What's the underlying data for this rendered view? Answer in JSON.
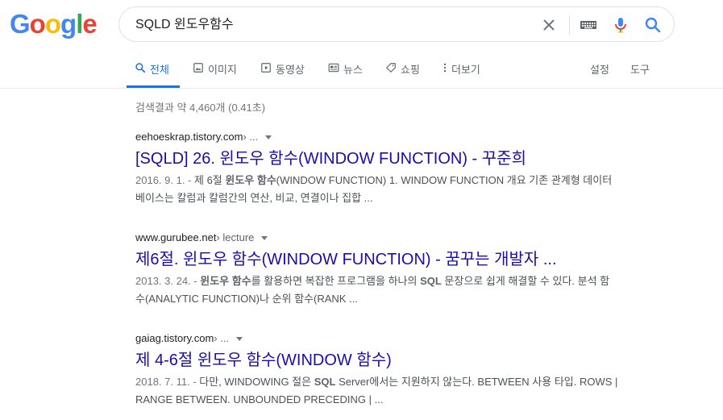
{
  "logo": {
    "letters": [
      "G",
      "o",
      "o",
      "g",
      "l",
      "e"
    ],
    "colors": [
      "#4285F4",
      "#EA4335",
      "#FBBC05",
      "#4285F4",
      "#34A853",
      "#EA4335"
    ]
  },
  "search": {
    "query": "SQLD 윈도우함수"
  },
  "icons": {
    "clear": "close-icon",
    "keyboard": "keyboard-icon",
    "voice": "microphone-icon",
    "search": "search-icon"
  },
  "tabs": [
    {
      "label": "전체",
      "icon": "search-icon",
      "active": true
    },
    {
      "label": "이미지",
      "icon": "image-icon"
    },
    {
      "label": "동영상",
      "icon": "video-icon"
    },
    {
      "label": "뉴스",
      "icon": "news-icon"
    },
    {
      "label": "쇼핑",
      "icon": "tag-icon"
    },
    {
      "label": "더보기",
      "icon": "more-vert-icon"
    }
  ],
  "tools": {
    "settings": "설정",
    "tools": "도구"
  },
  "stats": "검색결과 약 4,460개 (0.41초)",
  "results": [
    {
      "site": "eehoeskrap.tistory.com",
      "path": " › ...",
      "title": "[SQLD] 26. 윈도우 함수(WINDOW FUNCTION) - 꾸준희",
      "date": "2016. 9. 1. - ",
      "snippet": [
        {
          "t": "제 6절 "
        },
        {
          "t": "윈도우 함수",
          "b": true
        },
        {
          "t": "(WINDOW FUNCTION) 1. WINDOW FUNCTION 개요 기존 관계형 데이터베이스는 칼럼과 칼럼간의 연산, 비교, 연결이나 집합 ..."
        }
      ]
    },
    {
      "site": "www.gurubee.net",
      "path": " › lecture",
      "title": "제6절. 윈도우 함수(WINDOW FUNCTION) - 꿈꾸는 개발자 ...",
      "date": "2013. 3. 24. - ",
      "snippet": [
        {
          "t": "윈도우 함수",
          "b": true
        },
        {
          "t": "를 활용하면 복잡한 프로그램을 하나의 "
        },
        {
          "t": "SQL",
          "b": true
        },
        {
          "t": " 문장으로 쉽게 해결할 수 있다. 분석 함수(ANALYTIC FUNCTION)나 순위 함수(RANK ..."
        }
      ]
    },
    {
      "site": "gaiag.tistory.com",
      "path": " › ...",
      "title": "제 4-6절 윈도우 함수(WINDOW 함수)",
      "date": "2018. 7. 11. - ",
      "snippet": [
        {
          "t": "다만, WINDOWING 절은 "
        },
        {
          "t": "SQL",
          "b": true
        },
        {
          "t": " Server에서는 지원하지 않는다. BETWEEN 사용 타입. ROWS | RANGE BETWEEN. UNBOUNDED PRECEDING | ..."
        }
      ]
    }
  ]
}
